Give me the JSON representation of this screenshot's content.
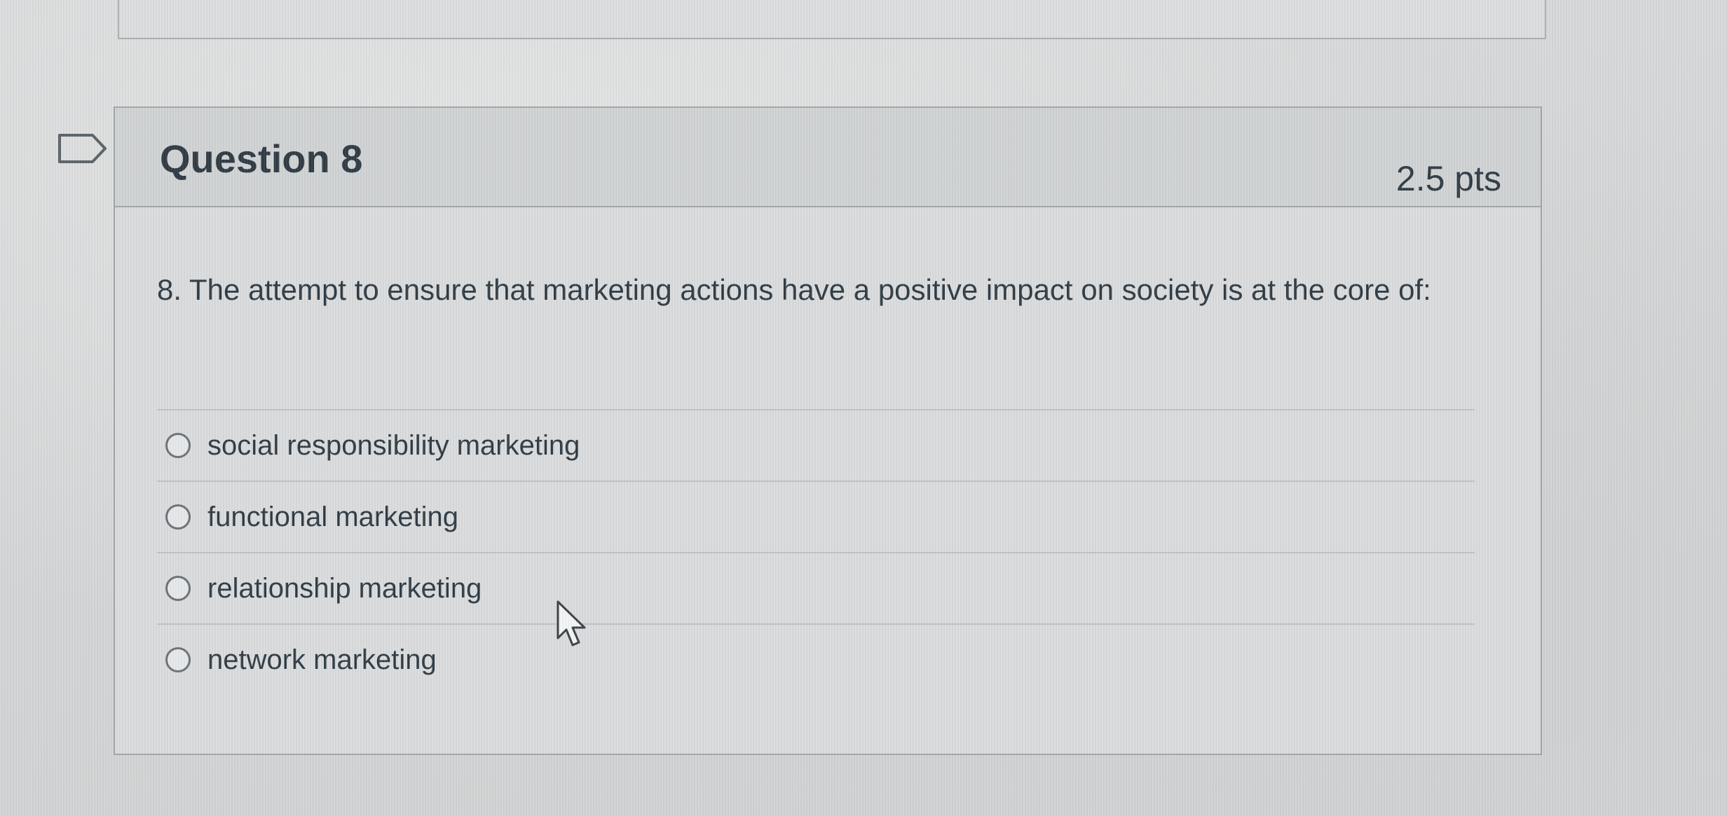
{
  "question": {
    "title": "Question 8",
    "points": "2.5 pts",
    "text": "8. The attempt to ensure that marketing actions have a positive impact on society is at the core of:"
  },
  "answers": [
    {
      "label": "social responsibility marketing",
      "selected": false
    },
    {
      "label": "functional marketing",
      "selected": false
    },
    {
      "label": "relationship marketing",
      "selected": false
    },
    {
      "label": "network marketing",
      "selected": false
    }
  ],
  "icons": {
    "flag": "flag-question-icon",
    "cursor": "mouse-pointer-icon"
  }
}
